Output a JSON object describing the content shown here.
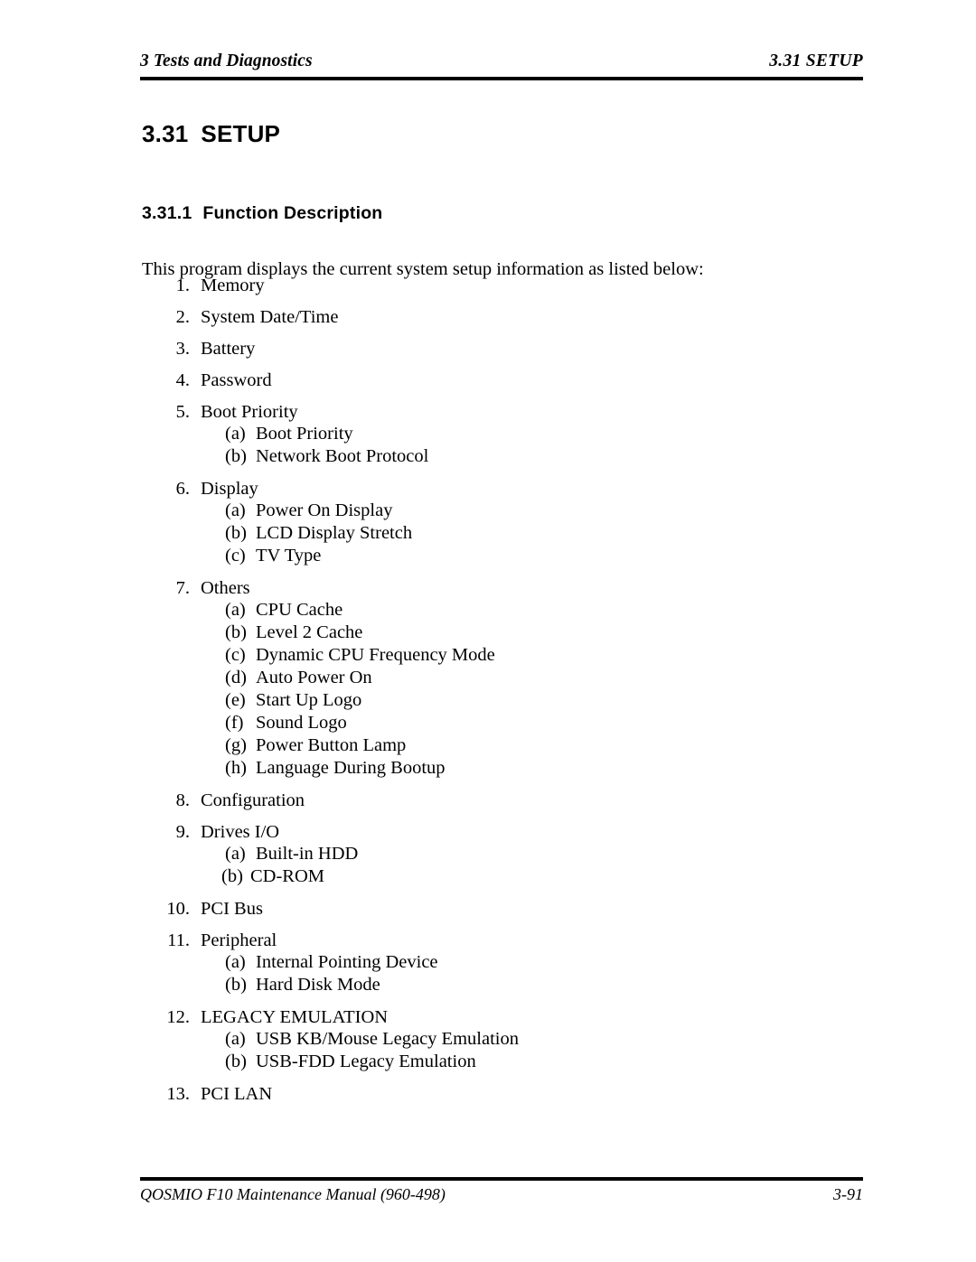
{
  "header": {
    "left": "3 Tests and Diagnostics",
    "right": "3.31  SETUP"
  },
  "section_heading": {
    "number": "3.31",
    "title": "SETUP"
  },
  "subsection_heading": {
    "number": "3.31.1",
    "title": "Function Description"
  },
  "intro": "This program displays the current system setup information as listed below:",
  "items": [
    {
      "marker": "1.",
      "label": "Memory",
      "subs": []
    },
    {
      "marker": "2.",
      "label": "System Date/Time",
      "subs": []
    },
    {
      "marker": "3.",
      "label": "Battery",
      "subs": []
    },
    {
      "marker": "4.",
      "label": "Password",
      "subs": []
    },
    {
      "marker": "5.",
      "label": "Boot Priority",
      "subs": [
        {
          "marker": "(a)",
          "label": "Boot Priority"
        },
        {
          "marker": "(b)",
          "label": "Network Boot Protocol"
        }
      ]
    },
    {
      "marker": "6.",
      "label": "Display",
      "subs": [
        {
          "marker": "(a)",
          "label": "Power On Display"
        },
        {
          "marker": "(b)",
          "label": "LCD Display Stretch"
        },
        {
          "marker": "(c)",
          "label": "TV Type"
        }
      ]
    },
    {
      "marker": "7.",
      "label": "Others",
      "subs": [
        {
          "marker": "(a)",
          "label": "CPU Cache"
        },
        {
          "marker": "(b)",
          "label": "Level 2 Cache"
        },
        {
          "marker": "(c)",
          "label": "Dynamic CPU Frequency Mode"
        },
        {
          "marker": "(d)",
          "label": "Auto Power On"
        },
        {
          "marker": "(e)",
          "label": "Start Up Logo"
        },
        {
          "marker": "(f)",
          "label": "Sound Logo"
        },
        {
          "marker": "(g)",
          "label": "Power Button Lamp"
        },
        {
          "marker": "(h)",
          "label": "Language During Bootup"
        }
      ]
    },
    {
      "marker": "8.",
      "label": "Configuration",
      "subs": []
    },
    {
      "marker": "9.",
      "label": "Drives I/O",
      "subs": [
        {
          "marker": "(a)",
          "label": "Built-in HDD"
        },
        {
          "marker": "(b)",
          "label": "CD-ROM",
          "tight": true
        }
      ]
    },
    {
      "marker": "10.",
      "label": "PCI Bus",
      "wide": true,
      "subs": []
    },
    {
      "marker": "11.",
      "label": "Peripheral",
      "wide": true,
      "subs": [
        {
          "marker": "(a)",
          "label": "Internal Pointing Device"
        },
        {
          "marker": "(b)",
          "label": "Hard Disk Mode"
        }
      ]
    },
    {
      "marker": "12.",
      "label": "LEGACY EMULATION",
      "wide": true,
      "subs": [
        {
          "marker": "(a)",
          "label": "USB KB/Mouse Legacy Emulation"
        },
        {
          "marker": "(b)",
          "label": "USB-FDD Legacy Emulation"
        }
      ]
    },
    {
      "marker": "13.",
      "label": "PCI LAN",
      "wide": true,
      "subs": []
    }
  ],
  "footer": {
    "left": "QOSMIO F10  Maintenance Manual (960-498)",
    "right": "3-91"
  }
}
